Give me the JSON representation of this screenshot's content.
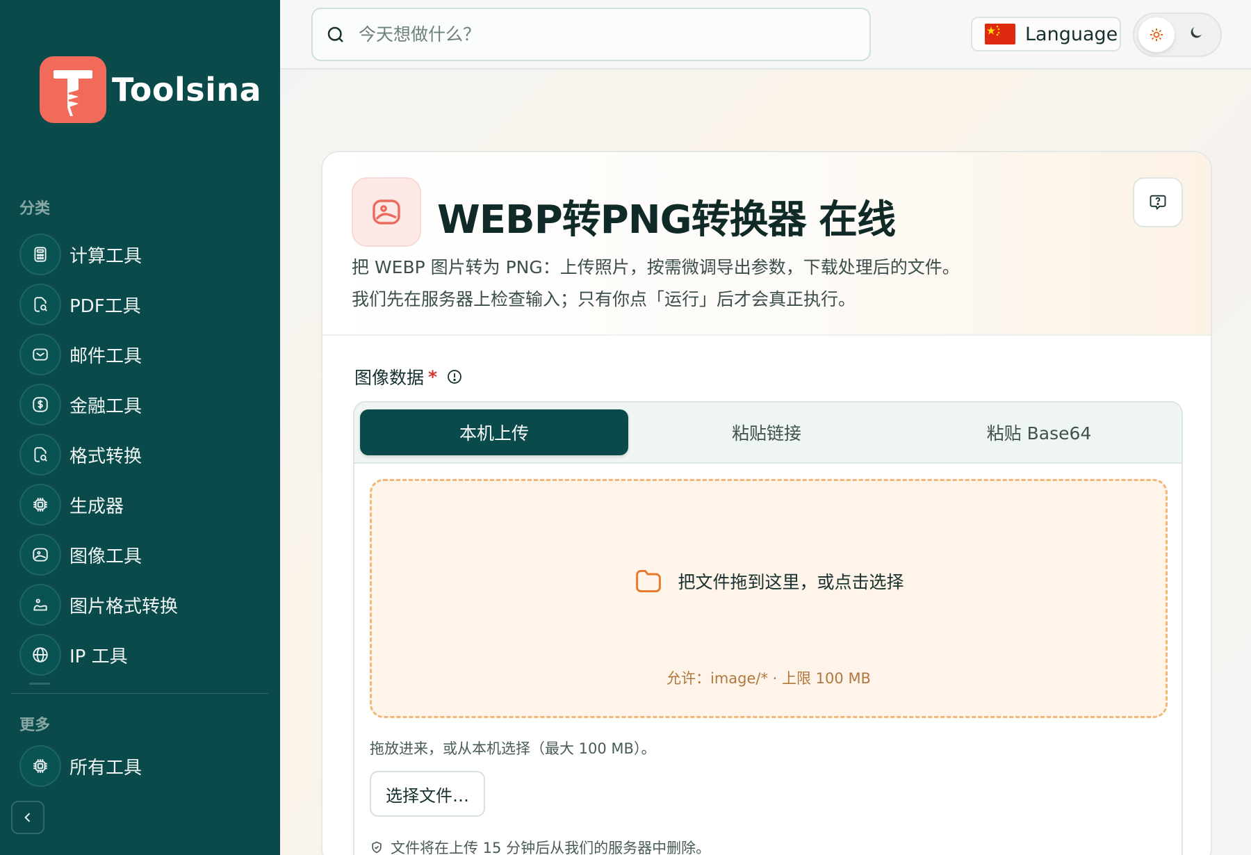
{
  "brand": {
    "name": "Toolsina"
  },
  "sidebar": {
    "section_categories": "分类",
    "items": [
      {
        "label": "计算工具",
        "icon": "calculator-icon"
      },
      {
        "label": "PDF工具",
        "icon": "document-icon"
      },
      {
        "label": "邮件工具",
        "icon": "mail-icon"
      },
      {
        "label": "金融工具",
        "icon": "dollar-icon"
      },
      {
        "label": "格式转换",
        "icon": "convert-icon"
      },
      {
        "label": "生成器",
        "icon": "chip-icon"
      },
      {
        "label": "图像工具",
        "icon": "image-icon"
      },
      {
        "label": "图片格式转换",
        "icon": "image-convert-icon"
      },
      {
        "label": "IP 工具",
        "icon": "globe-icon"
      }
    ],
    "section_more": "更多",
    "more_items": [
      {
        "label": "所有工具",
        "icon": "chip-icon"
      }
    ]
  },
  "topbar": {
    "search_placeholder": "今天想做什么？",
    "language_label": "Language"
  },
  "tool": {
    "title": "WEBP转PNG转换器 在线",
    "desc_line1": "把 WEBP 图片转为 PNG：上传照片，按需微调导出参数，下载处理后的文件。",
    "desc_line2": "我们先在服务器上检查输入；只有你点「运行」后才会真正执行。"
  },
  "form": {
    "field_label": "图像数据",
    "required_mark": "*",
    "tabs": [
      "本机上传",
      "粘贴链接",
      "粘贴 Base64"
    ],
    "active_tab": 0,
    "dropzone_text": "把文件拖到这里，或点击选择",
    "dropzone_allowed": "允许：image/* · 上限 100 MB",
    "hint": "拖放进来，或从本机选择（最大 100 MB）。",
    "choose_button": "选择文件…",
    "retention_note": "文件将在上传 15 分钟后从我们的服务器中删除。"
  },
  "colors": {
    "sidebar_bg": "#0b4a4a",
    "brand_accent": "#f26a5a",
    "dropzone_border": "#f2b677",
    "required": "#d1352b"
  }
}
